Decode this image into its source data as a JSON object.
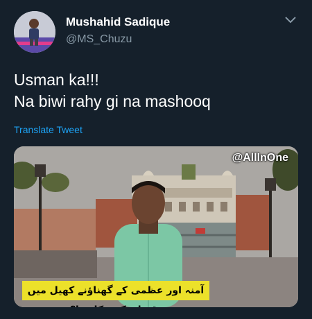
{
  "tweet": {
    "author_name": "Mushahid Sadique",
    "author_handle": "@MS_Chuzu",
    "text_lines": [
      "Usman ka!!!",
      "Na biwi rahy gi na mashooq"
    ],
    "translate_label": "Translate Tweet"
  },
  "media": {
    "watermark": "@AllInOne",
    "caption": "آمنہ اور عظمی کے گھناؤنے کھیل میں نقصان کس کا ہوا؟"
  },
  "icons": {
    "menu": "chevron-down-icon",
    "avatar": "profile-photo"
  },
  "colors": {
    "background": "#15202b",
    "link": "#1da1f2",
    "secondary_text": "#8899a6",
    "caption_bg": "#ece12a"
  }
}
